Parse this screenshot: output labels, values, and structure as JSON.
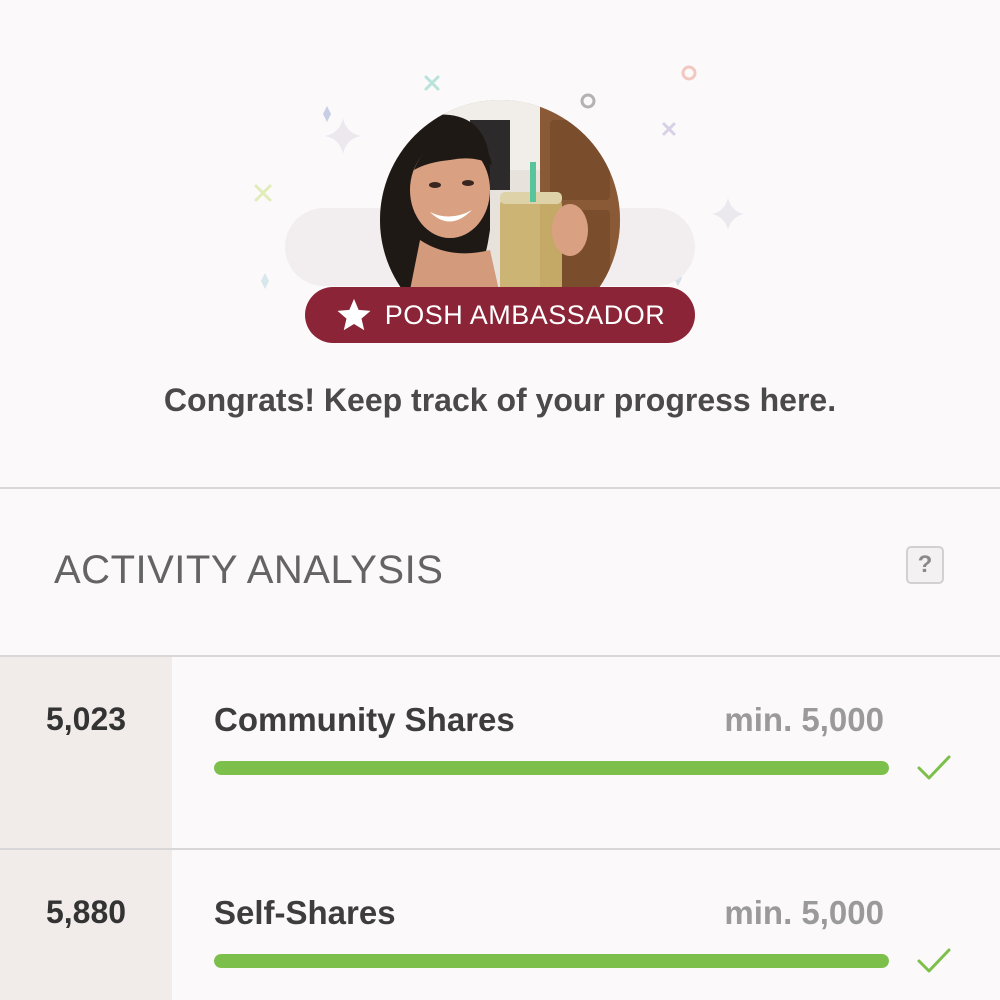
{
  "badge": {
    "label": "POSH AMBASSADOR",
    "icon": "star-icon",
    "color": "#8b2436"
  },
  "hero": {
    "message": "Congrats! Keep track of your progress here."
  },
  "activity": {
    "title": "ACTIVITY ANALYSIS",
    "help_label": "?",
    "metrics": [
      {
        "value": "5,023",
        "label": "Community Shares",
        "min_label": "min. 5,000",
        "progress_percent": 100,
        "status_icon": "check-icon"
      },
      {
        "value": "5,880",
        "label": "Self-Shares",
        "min_label": "min. 5,000",
        "progress_percent": 100,
        "status_icon": "check-icon"
      }
    ]
  },
  "colors": {
    "accent": "#8b2436",
    "progress": "#7cc04b",
    "check": "#7cc04b"
  }
}
